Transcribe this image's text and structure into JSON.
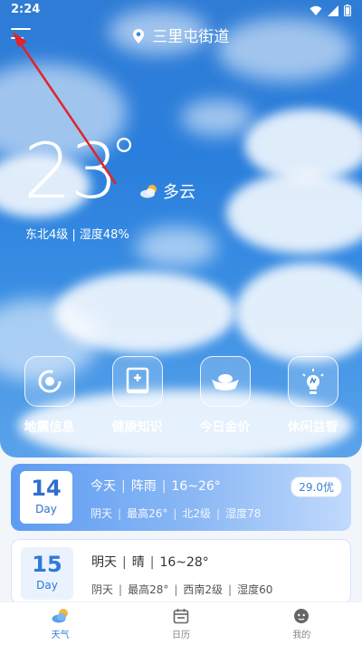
{
  "status_bar": {
    "time": "2:24"
  },
  "header": {
    "location": "三里屯街道"
  },
  "weather": {
    "temperature": "23",
    "unit": "°",
    "condition": "多云",
    "wind_humidity": "东北4级 | 湿度48%"
  },
  "tiles": [
    {
      "label": "地震信息",
      "icon": "spiral-icon"
    },
    {
      "label": "健康知识",
      "icon": "medical-book-icon"
    },
    {
      "label": "今日金价",
      "icon": "gold-ingot-icon"
    },
    {
      "label": "休闲益智",
      "icon": "lightbulb-icon"
    }
  ],
  "forecast": [
    {
      "day_number": "14",
      "day_unit": "Day",
      "day_name": "今天",
      "weather": "阵雨",
      "temp_range": "16~26°",
      "detail_1": "阴天",
      "detail_2": "最高26°",
      "detail_3": "北2级",
      "detail_4": "湿度78",
      "aqi": "29.0优"
    },
    {
      "day_number": "15",
      "day_unit": "Day",
      "day_name": "明天",
      "weather": "晴",
      "temp_range": "16~28°",
      "detail_1": "阴天",
      "detail_2": "最高28°",
      "detail_3": "西南2级",
      "detail_4": "湿度60"
    }
  ],
  "bottom_nav": [
    {
      "label": "天气",
      "icon": "weather-icon",
      "active": true
    },
    {
      "label": "日历",
      "icon": "calendar-icon",
      "active": false
    },
    {
      "label": "我的",
      "icon": "profile-icon",
      "active": false
    }
  ],
  "colors": {
    "sky_blue": "#2a7fdc",
    "accent_blue": "#2f7ad8",
    "annotation_red": "#e0242a"
  }
}
